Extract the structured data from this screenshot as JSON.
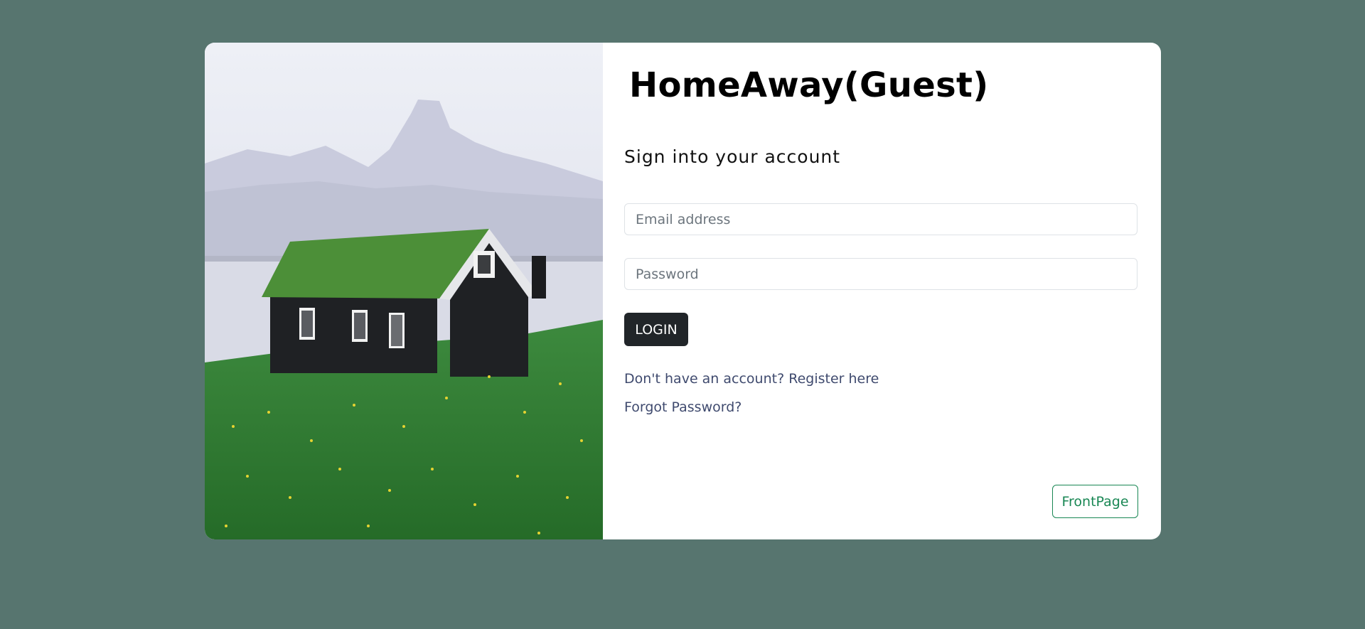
{
  "app": {
    "title": "HomeAway(Guest)"
  },
  "login": {
    "heading": "Sign into your account",
    "email_placeholder": "Email address",
    "password_placeholder": "Password",
    "login_label": "LOGIN",
    "register_prefix": "Don't have an account? ",
    "register_link": "Register here",
    "forgot_label": "Forgot Password?",
    "frontpage_label": "FrontPage"
  },
  "hero": {
    "image": "grass-roof-house-landscape"
  },
  "colors": {
    "background": "#57756F",
    "card": "#FFFFFF",
    "login_button": "#212529",
    "link": "#3F4A6E",
    "frontpage_accent": "#198754"
  }
}
